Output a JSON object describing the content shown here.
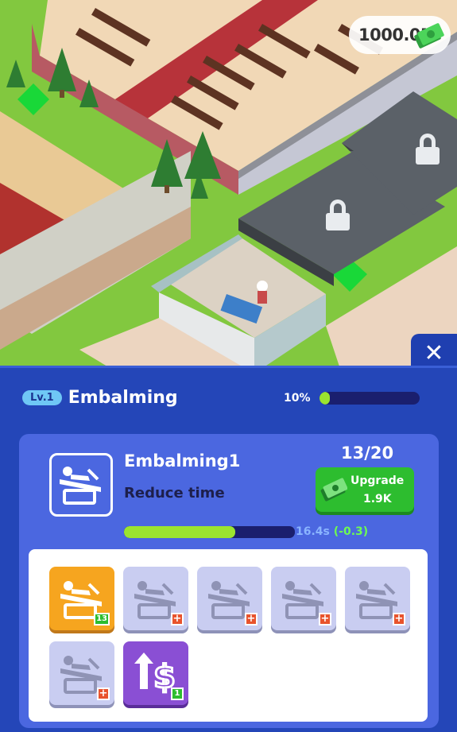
{
  "hud": {
    "money": "1000.0M",
    "money_icon": "cash-stack-icon"
  },
  "panel": {
    "close_label": "✕",
    "level_badge": "Lv.1",
    "title": "Embalming",
    "progress_text": "10%",
    "progress_fraction": 0.1
  },
  "item": {
    "name": "Embalming1",
    "description": "Reduce time",
    "count": "13/20",
    "upgrade_label": "Upgrade",
    "upgrade_cost": "1.9K",
    "time_fraction": 0.65,
    "time_value": "16.4s",
    "time_delta": "(-0.3)"
  },
  "slots": [
    {
      "state": "active",
      "icon": "embalming-table-icon",
      "badge": "13"
    },
    {
      "state": "locked",
      "icon": "embalming-table-icon",
      "badge": "+"
    },
    {
      "state": "locked",
      "icon": "embalming-table-icon",
      "badge": "+"
    },
    {
      "state": "locked",
      "icon": "embalming-table-icon",
      "badge": "+"
    },
    {
      "state": "locked",
      "icon": "embalming-table-icon",
      "badge": "+"
    },
    {
      "state": "locked",
      "icon": "embalming-table-icon",
      "badge": "+"
    },
    {
      "state": "special",
      "icon": "price-up-icon",
      "badge": "1"
    }
  ],
  "colors": {
    "panel_bg": "#2446b8",
    "card_bg": "#4b67e0",
    "accent_green": "#2dbd2f",
    "progress_fill": "#9be42f"
  }
}
